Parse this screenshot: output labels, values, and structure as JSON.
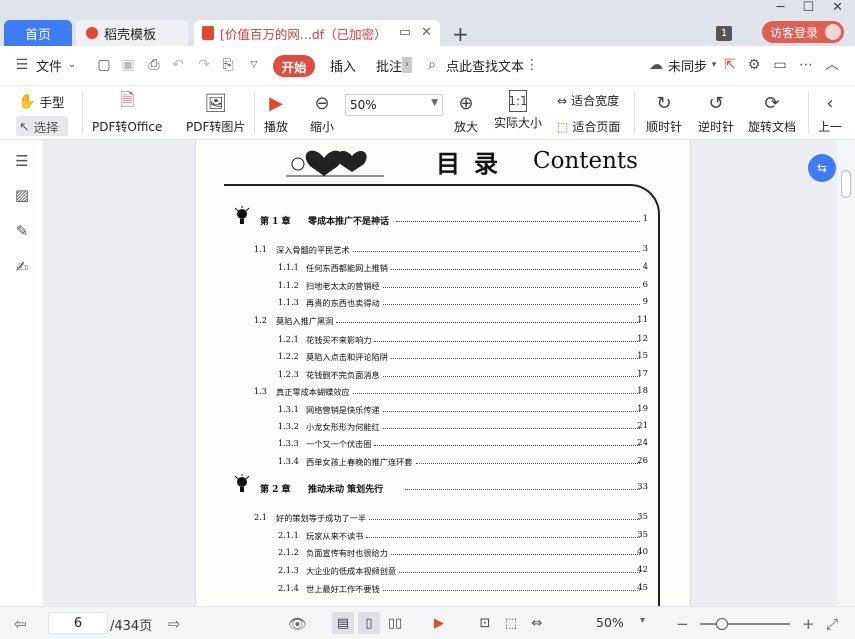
{
  "tabs": {
    "home": "首页",
    "template": "稻壳模板",
    "document": "[价值百万的网...df（已加密）",
    "badge": "1",
    "login": "访客登录"
  },
  "menu": {
    "file": "文件",
    "start": "开始",
    "insert": "插入",
    "annotate": "批注",
    "search_placeholder": "点此查找文本",
    "sync": "未同步"
  },
  "ribbon": {
    "hand": "手型",
    "select": "选择",
    "pdf_to_office": "PDF转Office",
    "pdf_to_image": "PDF转图片",
    "play": "播放",
    "zoom_out": "缩小",
    "zoom_value": "50%",
    "zoom_in": "放大",
    "actual_size": "实际大小",
    "fit_width": "适合宽度",
    "fit_page": "适合页面",
    "rotate_cw": "顺时针",
    "rotate_ccw": "逆时针",
    "rotate_doc": "旋转文档",
    "prev": "上一"
  },
  "page_content": {
    "title_cn": "目录",
    "title_en": "Contents",
    "entries": [
      {
        "level": 0,
        "num": "第 1 章",
        "text": "零成本推广不是神话",
        "page": "1"
      },
      {
        "level": 1,
        "num": "1.1",
        "text": "深入骨髓的平民艺术",
        "page": "3"
      },
      {
        "level": 2,
        "num": "1.1.1",
        "text": "任何东西都能网上推销",
        "page": "4"
      },
      {
        "level": 2,
        "num": "1.1.2",
        "text": "扫地老太太的营销经",
        "page": "6"
      },
      {
        "level": 2,
        "num": "1.1.3",
        "text": "再贵的东西也卖得动",
        "page": "9"
      },
      {
        "level": 1,
        "num": "1.2",
        "text": "莫陷入推广黑洞",
        "page": "11"
      },
      {
        "level": 2,
        "num": "1.2.1",
        "text": "花钱买不来影响力",
        "page": "12"
      },
      {
        "level": 2,
        "num": "1.2.2",
        "text": "莫陷入点击和评论陷阱",
        "page": "15"
      },
      {
        "level": 2,
        "num": "1.2.3",
        "text": "花钱删不完负面消息",
        "page": "17"
      },
      {
        "level": 1,
        "num": "1.3",
        "text": "真正零成本蝴蝶效应",
        "page": "18"
      },
      {
        "level": 2,
        "num": "1.3.1",
        "text": "网络营销是快乐传递",
        "page": "19"
      },
      {
        "level": 2,
        "num": "1.3.2",
        "text": "小龙女形形为何能红",
        "page": "21"
      },
      {
        "level": 2,
        "num": "1.3.3",
        "text": "一个又一个伏击圈",
        "page": "24"
      },
      {
        "level": 2,
        "num": "1.3.4",
        "text": "西单女孩上春晚的推广连环套",
        "page": "26"
      },
      {
        "level": 0,
        "num": "第 2 章",
        "text": "推动未动  策划先行",
        "page": "33"
      },
      {
        "level": 1,
        "num": "2.1",
        "text": "好的策划等于成功了一半",
        "page": "35"
      },
      {
        "level": 2,
        "num": "2.1.1",
        "text": "玩家从来不读书",
        "page": "35"
      },
      {
        "level": 2,
        "num": "2.1.2",
        "text": "负面宣传有时也很给力",
        "page": "40"
      },
      {
        "level": 2,
        "num": "2.1.3",
        "text": "大企业的低成本视频创意",
        "page": "42"
      },
      {
        "level": 2,
        "num": "2.1.4",
        "text": "世上最好工作不要钱",
        "page": "45"
      }
    ]
  },
  "status": {
    "current_page": "6",
    "total_pages": "/434页",
    "zoom": "50%"
  }
}
